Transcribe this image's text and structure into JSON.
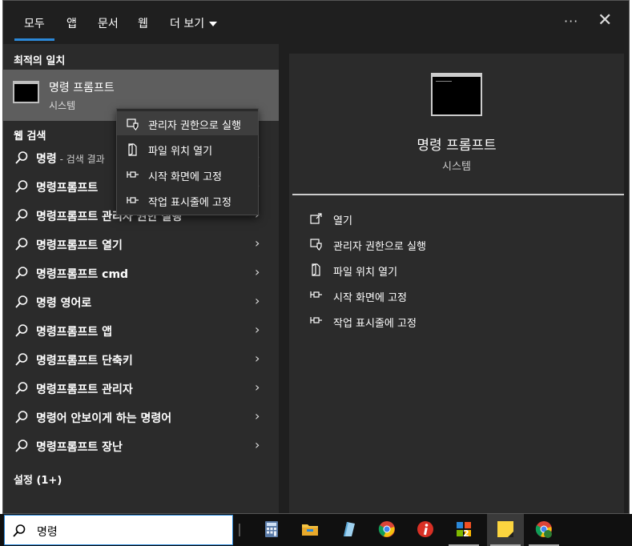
{
  "tabs": [
    {
      "label": "모두"
    },
    {
      "label": "앱"
    },
    {
      "label": "문서"
    },
    {
      "label": "웹"
    },
    {
      "label": "더 보기"
    }
  ],
  "header": {
    "more_label": "···",
    "close_label": "✕"
  },
  "best_match": {
    "section_label": "최적의 일치",
    "title": "명령 프롬프트",
    "subtitle": "시스템"
  },
  "web_search": {
    "section_label": "웹 검색",
    "results": [
      {
        "text": "명령",
        "suffix": " - 검색 결과"
      },
      {
        "text": "명령프롬프트",
        "suffix": ""
      },
      {
        "text": "명령프롬프트 관리자 권한 실행",
        "suffix": ""
      },
      {
        "text": "명령프롬프트 열기",
        "suffix": ""
      },
      {
        "text": "명령프롬프트 cmd",
        "suffix": ""
      },
      {
        "text": "명령 영어로",
        "suffix": ""
      },
      {
        "text": "명령프롬프트 앱",
        "suffix": ""
      },
      {
        "text": "명령프롬프트 단축키",
        "suffix": ""
      },
      {
        "text": "명령프롬프트 관리자",
        "suffix": ""
      },
      {
        "text": "명령어 안보이게 하는 명령어",
        "suffix": ""
      },
      {
        "text": "명령프롬프트 장난",
        "suffix": ""
      }
    ]
  },
  "settings": {
    "section_label": "설정 (1+)"
  },
  "context_menu": {
    "items": [
      {
        "label": "관리자 권한으로 실행",
        "icon": "shield-icon"
      },
      {
        "label": "파일 위치 열기",
        "icon": "file-location-icon"
      },
      {
        "label": "시작 화면에 고정",
        "icon": "pin-icon"
      },
      {
        "label": "작업 표시줄에 고정",
        "icon": "pin-icon"
      }
    ]
  },
  "detail": {
    "title": "명령 프롬프트",
    "subtitle": "시스템",
    "actions": [
      {
        "label": "열기",
        "icon": "open-icon"
      },
      {
        "label": "관리자 권한으로 실행",
        "icon": "shield-icon"
      },
      {
        "label": "파일 위치 열기",
        "icon": "file-location-icon"
      },
      {
        "label": "시작 화면에 고정",
        "icon": "pin-icon"
      },
      {
        "label": "작업 표시줄에 고정",
        "icon": "pin-icon"
      }
    ]
  },
  "taskbar": {
    "search_value": "명령",
    "apps": [
      {
        "name": "calculator-icon"
      },
      {
        "name": "file-explorer-icon"
      },
      {
        "name": "notepad-icon"
      },
      {
        "name": "chrome-icon"
      },
      {
        "name": "info-app-icon"
      },
      {
        "name": "windows-grid-icon",
        "badge": "2"
      },
      {
        "name": "sticky-notes-icon"
      },
      {
        "name": "chrome-profile-icon"
      }
    ]
  },
  "colors": {
    "accent": "#2b88d8",
    "panel": "#1f1f1f",
    "list_bg": "#2b2b2b",
    "highlight": "#5e5e5e"
  }
}
